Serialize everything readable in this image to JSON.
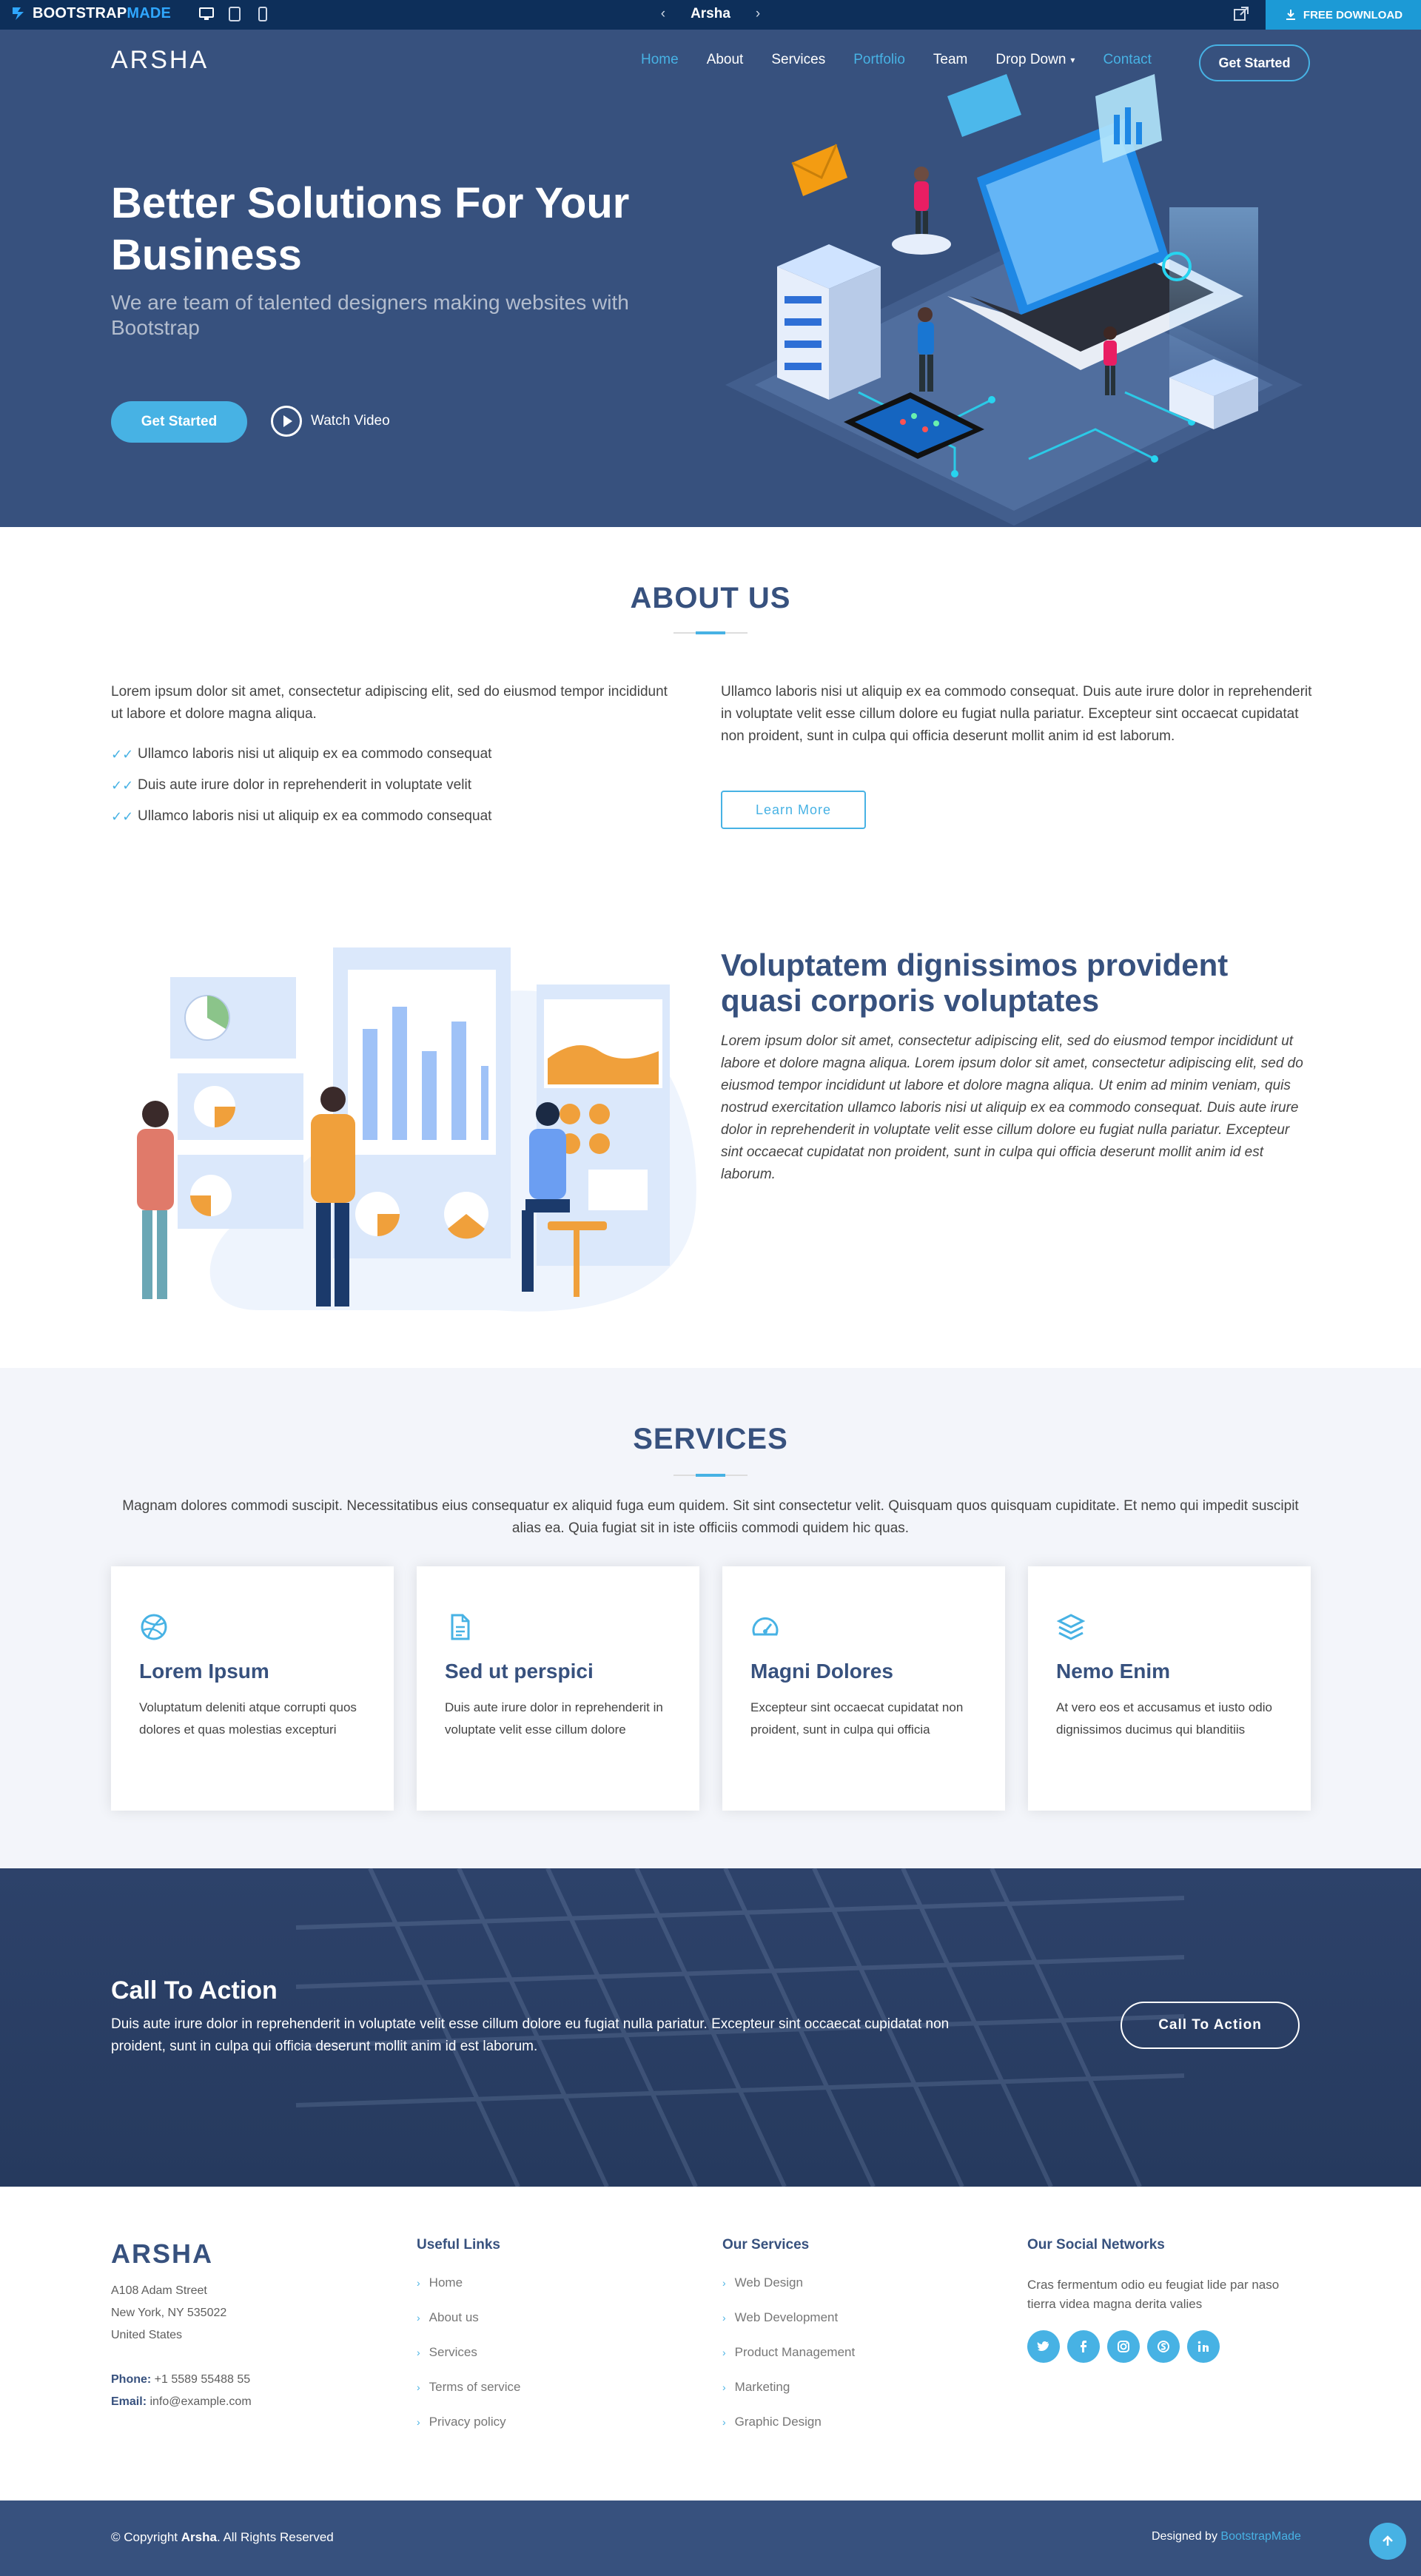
{
  "topbar": {
    "brand_bootstrap": "BOOTSTRAP",
    "brand_made": "MADE",
    "center_title": "Arsha",
    "download_label": "FREE DOWNLOAD",
    "icons": [
      "desktop-icon",
      "tablet-icon",
      "mobile-icon",
      "external-link-icon",
      "download-icon"
    ]
  },
  "header": {
    "logo": "ARSHA",
    "nav": [
      {
        "label": "Home",
        "active": true
      },
      {
        "label": "About"
      },
      {
        "label": "Services"
      },
      {
        "label": "Portfolio",
        "active": true
      },
      {
        "label": "Team"
      },
      {
        "label": "Drop Down"
      },
      {
        "label": "Contact",
        "active": true
      }
    ],
    "cta_label": "Get Started"
  },
  "hero": {
    "title": "Better Solutions For Your Business",
    "subtitle": "We are team of talented designers making websites with Bootstrap",
    "primary_button": "Get Started",
    "watch_label": "Watch Video"
  },
  "about": {
    "title": "ABOUT US",
    "left_text": "Lorem ipsum dolor sit amet, consectetur adipiscing elit, sed do eiusmod tempor incididunt ut labore et dolore magna aliqua.",
    "list": [
      "Ullamco laboris nisi ut aliquip ex ea commodo consequat",
      "Duis aute irure dolor in reprehenderit in voluptate velit",
      "Ullamco laboris nisi ut aliquip ex ea commodo consequat"
    ],
    "right_text": "Ullamco laboris nisi ut aliquip ex ea commodo consequat. Duis aute irure dolor in reprehenderit in voluptate velit esse cillum dolore eu fugiat nulla pariatur. Excepteur sint occaecat cupidatat non proident, sunt in culpa qui officia deserunt mollit anim id est laborum.",
    "button": "Learn More"
  },
  "why": {
    "title": "Voluptatem dignissimos provident quasi corporis voluptates",
    "text": "Lorem ipsum dolor sit amet, consectetur adipiscing elit, sed do eiusmod tempor incididunt ut labore et dolore magna aliqua. Lorem ipsum dolor sit amet, consectetur adipiscing elit, sed do eiusmod tempor incididunt ut labore et dolore magna aliqua. Ut enim ad minim veniam, quis nostrud exercitation ullamco laboris nisi ut aliquip ex ea commodo consequat. Duis aute irure dolor in reprehenderit in voluptate velit esse cillum dolore eu fugiat nulla pariatur. Excepteur sint occaecat cupidatat non proident, sunt in culpa qui officia deserunt mollit anim id est laborum."
  },
  "services": {
    "title": "SERVICES",
    "intro": "Magnam dolores commodi suscipit. Necessitatibus eius consequatur ex aliquid fuga eum quidem. Sit sint consectetur velit. Quisquam quos quisquam cupiditate. Et nemo qui impedit suscipit alias ea. Quia fugiat sit in iste officiis commodi quidem hic quas.",
    "cards": [
      {
        "icon": "dribbble-icon",
        "title": "Lorem Ipsum",
        "text": "Voluptatum deleniti atque corrupti quos dolores et quas molestias excepturi"
      },
      {
        "icon": "file-icon",
        "title": "Sed ut perspici",
        "text": "Duis aute irure dolor in reprehenderit in voluptate velit esse cillum dolore"
      },
      {
        "icon": "speedometer-icon",
        "title": "Magni Dolores",
        "text": "Excepteur sint occaecat cupidatat non proident, sunt in culpa qui officia"
      },
      {
        "icon": "layers-icon",
        "title": "Nemo Enim",
        "text": "At vero eos et accusamus et iusto odio dignissimos ducimus qui blanditiis"
      }
    ]
  },
  "cta": {
    "title": "Call To Action",
    "text": "Duis aute irure dolor in reprehenderit in voluptate velit esse cillum dolore eu fugiat nulla pariatur. Excepteur sint occaecat cupidatat non proident, sunt in culpa qui officia deserunt mollit anim id est laborum.",
    "button": "Call To Action"
  },
  "footer": {
    "brand": "ARSHA",
    "address_line1": "A108 Adam Street",
    "address_line2": "New York, NY 535022",
    "address_line3": "United States",
    "phone_label": "Phone:",
    "phone": "+1 5589 55488 55",
    "email_label": "Email:",
    "email": "info@example.com",
    "useful_links_title": "Useful Links",
    "useful_links": [
      "Home",
      "About us",
      "Services",
      "Terms of service",
      "Privacy policy"
    ],
    "services_title": "Our Services",
    "services_links": [
      "Web Design",
      "Web Development",
      "Product Management",
      "Marketing",
      "Graphic Design"
    ],
    "social_title": "Our Social Networks",
    "social_text": "Cras fermentum odio eu feugiat lide par naso tierra videa magna derita valies",
    "social_icons": [
      "twitter-icon",
      "facebook-icon",
      "instagram-icon",
      "skype-icon",
      "linkedin-icon"
    ]
  },
  "bottom": {
    "copyright_prefix": "© Copyright",
    "copyright_brand": "Arsha",
    "copyright_suffix": ". All Rights Reserved",
    "designed_by": "Designed by",
    "designer_link": "BootstrapMade"
  },
  "colors": {
    "primary": "#37517e",
    "accent": "#47b2e4",
    "topbar": "#0d2f5a",
    "download": "#1c9ad6"
  }
}
